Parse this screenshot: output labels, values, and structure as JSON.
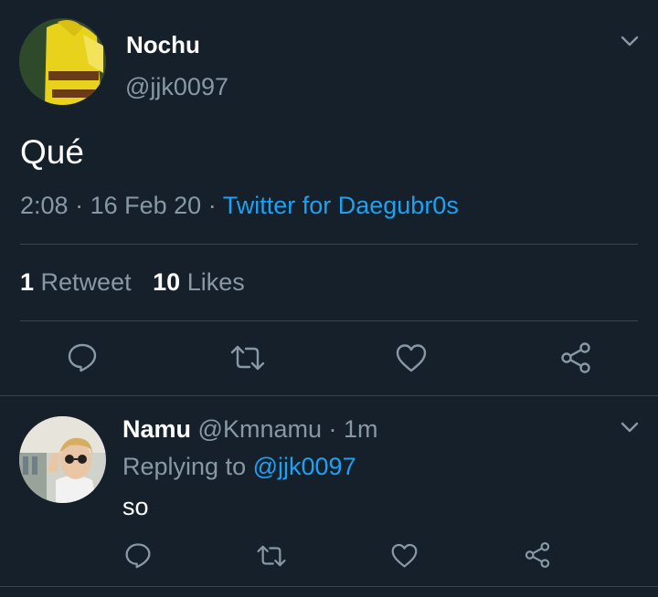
{
  "tweet": {
    "author_name": "Nochu",
    "author_handle": "@jjk0097",
    "text": "Qué",
    "time": "2:08",
    "separator": "·",
    "date": "16 Feb 20",
    "source": "Twitter for Daegubr0s",
    "retweet_count": "1",
    "retweet_label": "Retweet",
    "like_count": "10",
    "like_label": "Likes"
  },
  "reply": {
    "author_name": "Namu",
    "author_handle": "@Kmnamu",
    "separator": "·",
    "time_ago": "1m",
    "replying_label": "Replying to",
    "replying_handle": "@jjk0097",
    "text": "so"
  },
  "icons": {
    "chevron": "chevron-down-icon",
    "reply": "reply-icon",
    "retweet": "retweet-icon",
    "like": "heart-icon",
    "share": "share-icon"
  },
  "colors": {
    "background": "#15202b",
    "text_primary": "#ffffff",
    "text_secondary": "#8899a6",
    "accent": "#1da1f2",
    "divider": "#38444d"
  }
}
